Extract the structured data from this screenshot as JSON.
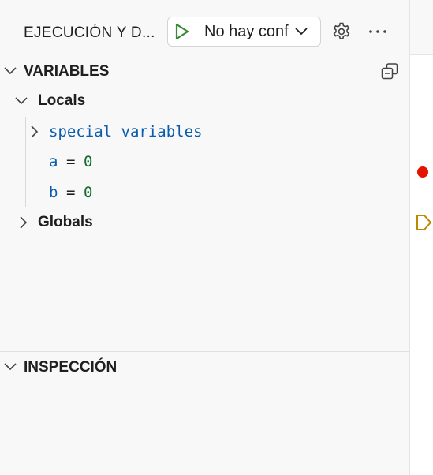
{
  "header": {
    "title": "EJECUCIÓN Y D...",
    "launch_config": "No hay configuraciones",
    "launch_config_shown": "No hay conf"
  },
  "variables_section": {
    "title": "VARIABLES",
    "scopes": [
      {
        "label": "Locals",
        "expanded": true,
        "children": [
          {
            "type": "group",
            "label": "special variables",
            "expanded": false
          },
          {
            "type": "var",
            "name": "a",
            "eq": "=",
            "value": "0"
          },
          {
            "type": "var",
            "name": "b",
            "eq": "=",
            "value": "0"
          }
        ]
      },
      {
        "label": "Globals",
        "expanded": false
      }
    ]
  },
  "watch_section": {
    "title": "INSPECCIÓN"
  },
  "icons": {
    "play": "play-icon",
    "chevron_down": "chevron-down-icon",
    "chevron_right": "chevron-right-icon",
    "gear": "gear-icon",
    "more": "ellipsis-icon",
    "collapse_all": "collapse-all-icon",
    "breakpoint": "breakpoint-dot-icon",
    "stack_frame": "stack-frame-icon"
  },
  "colors": {
    "play_green": "#388a34",
    "breakpoint_red": "#e51400",
    "stack_frame_yellow": "#be8700",
    "var_name_blue": "#0b5cad",
    "var_value_green": "#116b2e"
  }
}
